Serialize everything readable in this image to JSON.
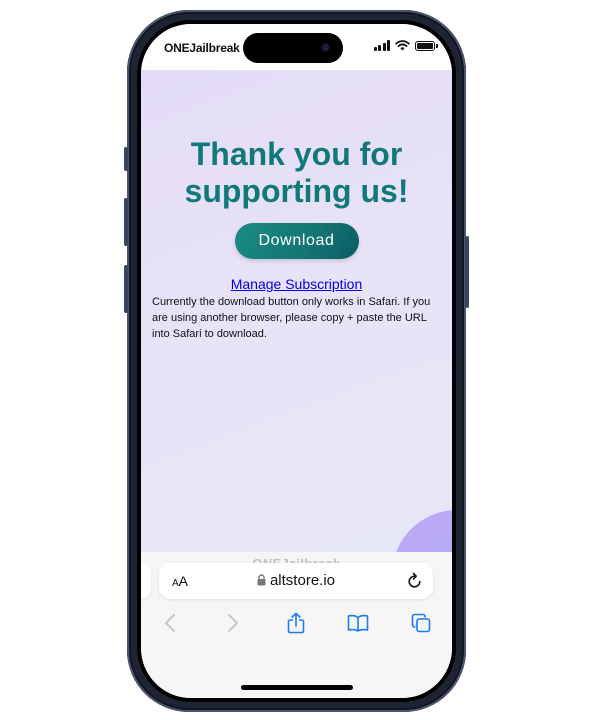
{
  "status_bar": {
    "carrier": "ONEJailbreak",
    "icons": [
      "cellular-signal-icon",
      "wifi-icon",
      "battery-icon"
    ]
  },
  "page": {
    "headline": "Thank you for supporting us!",
    "download_button": "Download",
    "manage_link": "Manage Subscription",
    "note": "Currently the download button only works in Safari. If you are using another browser, please copy + paste the URL into Safari to download."
  },
  "safari": {
    "watermark": "ONEJailbreak",
    "text_size_button": {
      "small": "A",
      "large": "A"
    },
    "url": "altstore.io",
    "icons": {
      "lock": "lock-icon",
      "reload": "reload-icon",
      "back": "back-chevron-icon",
      "forward": "forward-chevron-icon",
      "share": "share-icon",
      "bookmarks": "bookmarks-icon",
      "tabs": "tabs-icon"
    }
  },
  "colors": {
    "headline": "#11797a",
    "button": "#137574",
    "link": "#0000ee",
    "safari_accent": "#1a7cf0"
  }
}
